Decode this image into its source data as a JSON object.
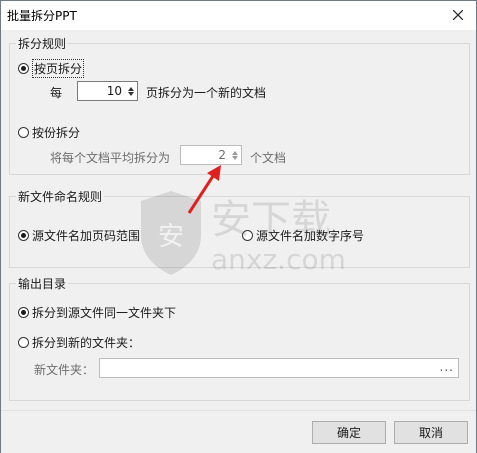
{
  "window": {
    "title": "批量拆分PPT"
  },
  "rules": {
    "legend": "拆分规则",
    "by_page": {
      "label": "按页拆分",
      "selected": true
    },
    "per_prefix": "每",
    "pages_value": "10",
    "per_suffix": "页拆分为一个新的文档",
    "by_copies": {
      "label": "按份拆分",
      "selected": false
    },
    "copies_prefix": "将每个文档平均拆分为",
    "copies_value": "2",
    "copies_suffix": "个文档"
  },
  "naming": {
    "legend": "新文件命名规则",
    "opt1": {
      "label": "源文件名加页码范围",
      "selected": true
    },
    "opt2": {
      "label": "源文件名加数字序号",
      "selected": false
    }
  },
  "output": {
    "legend": "输出目录",
    "opt1": {
      "label": "拆分到源文件同一文件夹下",
      "selected": true
    },
    "opt2": {
      "label": "拆分到新的文件夹：",
      "selected": false
    },
    "folder_label": "新文件夹：",
    "folder_value": "",
    "browse_label": "..."
  },
  "buttons": {
    "ok": "确定",
    "cancel": "取消"
  },
  "watermark": {
    "brand": "安下载",
    "domain": "anxz.com",
    "badge": "安"
  },
  "colors": {
    "arrow": "#e02020"
  }
}
